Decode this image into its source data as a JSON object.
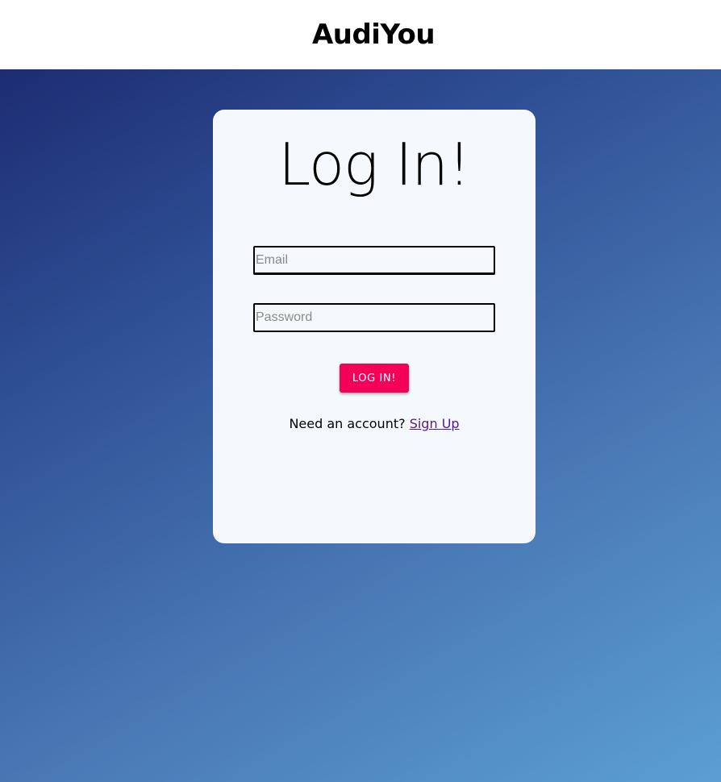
{
  "header": {
    "brand": "AudiYou"
  },
  "login": {
    "title": "Log In!",
    "email_placeholder": "Email",
    "email_value": "",
    "password_placeholder": "Password",
    "password_value": "",
    "submit_label": "LOG IN!",
    "signup_prompt": "Need an account?",
    "signup_link": "Sign Up"
  },
  "colors": {
    "accent_button": "#f50057",
    "link_visited": "#551a8b",
    "card_background": "#f5f9fd",
    "gradient_start": "#1d2c73",
    "gradient_end": "#5b9fd3"
  }
}
